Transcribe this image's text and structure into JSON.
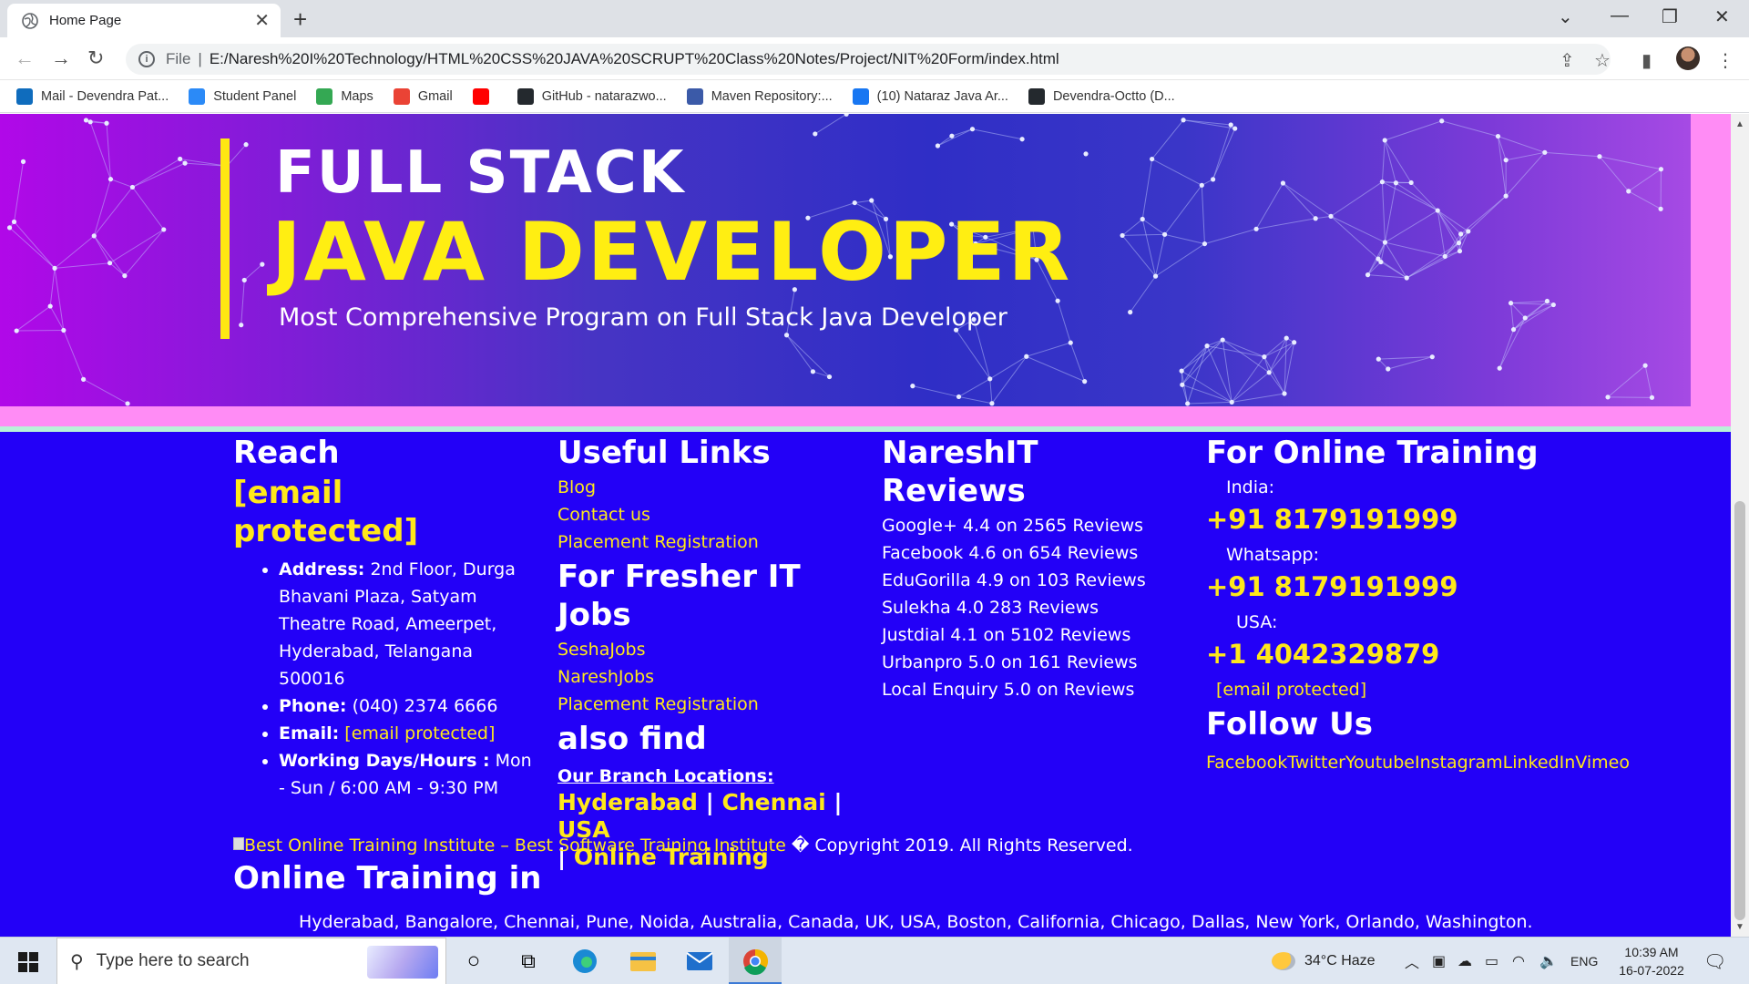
{
  "browser": {
    "tab_title": "Home Page",
    "url_scheme": "File",
    "url": "E:/Naresh%20I%20Technology/HTML%20CSS%20JAVA%20SCRUPT%20Class%20Notes/Project/NIT%20Form/index.html",
    "bookmarks": [
      {
        "label": "Mail - Devendra Pat...",
        "icon": "outlook-icon",
        "color": "#0f6cbd"
      },
      {
        "label": "Student Panel",
        "icon": "student-panel-icon",
        "color": "#2b8af7"
      },
      {
        "label": "Maps",
        "icon": "maps-icon",
        "color": "#34a853"
      },
      {
        "label": "Gmail",
        "icon": "gmail-icon",
        "color": "#ea4335"
      },
      {
        "label": "",
        "icon": "youtube-icon",
        "color": "#ff0000"
      },
      {
        "label": "GitHub - natarazwo...",
        "icon": "github-icon",
        "color": "#24292e"
      },
      {
        "label": "Maven Repository:...",
        "icon": "maven-icon",
        "color": "#3b5aa8"
      },
      {
        "label": "(10) Nataraz Java Ar...",
        "icon": "facebook-icon",
        "color": "#1877f2"
      },
      {
        "label": "Devendra-Octto (D...",
        "icon": "github-icon",
        "color": "#24292e"
      }
    ]
  },
  "banner": {
    "line1": "FULL STACK",
    "line2": "JAVA DEVELOPER",
    "subtitle": "Most Comprehensive Program on Full Stack Java Developer"
  },
  "footer": {
    "reach": {
      "heading": "Reach",
      "email_heading": "[email protected]",
      "address_label": "Address:",
      "address_text": "2nd Floor, Durga Bhavani Plaza, Satyam Theatre Road, Ameerpet, Hyderabad, Telangana 500016",
      "phone_label": "Phone:",
      "phone_text": "(040) 2374 6666",
      "email_label": "Email:",
      "email_text": "[email protected]",
      "hours_label": "Working Days/Hours :",
      "hours_text": "Mon - Sun / 6:00 AM - 9:30 PM"
    },
    "useful": {
      "heading": "Useful Links",
      "links": [
        "Blog",
        "Contact us",
        "Placement Registration"
      ],
      "fresher_heading": "For Fresher IT Jobs",
      "fresher_links": [
        "SeshaJobs",
        "NareshJobs",
        "Placement Registration"
      ],
      "also_find": "also find",
      "branch_heading": "Our Branch Locations:",
      "branches": [
        "Hyderabad",
        "Chennai",
        "USA",
        "Online Training"
      ],
      "sep": "|"
    },
    "reviews": {
      "heading": "NareshIT Reviews",
      "items": [
        "Google+ 4.4 on 2565 Reviews",
        "Facebook 4.6 on 654 Reviews",
        "EduGorilla 4.9 on 103 Reviews",
        "Sulekha 4.0 283 Reviews",
        "Justdial 4.1 on 5102 Reviews",
        "Urbanpro 5.0 on 161 Reviews",
        "Local Enquiry 5.0 on Reviews"
      ]
    },
    "online": {
      "heading": "For Online Training",
      "india_label": "India:",
      "india_phone": "+91 8179191999",
      "whatsapp_label": "Whatsapp:",
      "whatsapp_phone": "+91 8179191999",
      "usa_label": "USA:",
      "usa_phone": "+1 4042329879",
      "email": "[email protected]",
      "follow_heading": "Follow Us",
      "social": [
        "Facebook",
        "Twitter",
        "Youtube",
        "Instagram",
        "LinkedIn",
        "Vimeo"
      ]
    },
    "copyright_alt": "Best Online Training Institute – Best Software Training Institute",
    "copyright_text": "� Copyright 2019. All Rights Reserved.",
    "online_training_heading": "Online Training in",
    "cities": "Hyderabad, Bangalore, Chennai, Pune, Noida, Australia, Canada, UK, USA, Boston, California, Chicago, Dallas, New York, Orlando, Washington."
  },
  "taskbar": {
    "search_placeholder": "Type here to search",
    "weather": "34°C  Haze",
    "lang": "ENG",
    "time": "10:39 AM",
    "date": "16-07-2022"
  }
}
